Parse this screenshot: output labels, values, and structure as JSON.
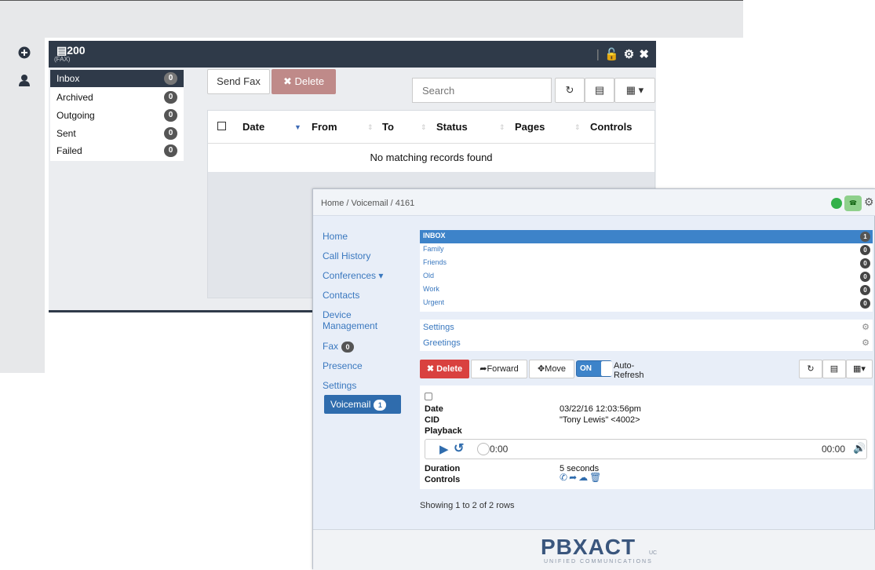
{
  "fax": {
    "extension": "200",
    "subtitle": "(FAX)",
    "folders": [
      {
        "label": "Inbox",
        "count": "0"
      },
      {
        "label": "Archived",
        "count": "0"
      },
      {
        "label": "Outgoing",
        "count": "0"
      },
      {
        "label": "Sent",
        "count": "0"
      },
      {
        "label": "Failed",
        "count": "0"
      }
    ],
    "send_label": "Send Fax",
    "delete_label": "Delete",
    "search_placeholder": "Search",
    "columns": [
      "Date",
      "From",
      "To",
      "Status",
      "Pages",
      "Controls"
    ],
    "empty_message": "No matching records found"
  },
  "voicemail": {
    "breadcrumb": "Home / Voicemail / 4161",
    "avatar_text": "☎",
    "nav": {
      "home": "Home",
      "call_history": "Call History",
      "conferences": "Conferences ▾",
      "contacts": "Contacts",
      "device_1": "Device",
      "device_2": "Management",
      "fax": "Fax",
      "fax_count": "0",
      "presence": "Presence",
      "settings": "Settings",
      "voicemail": "Voicemail",
      "voicemail_count": "1"
    },
    "folders": [
      {
        "label": "INBOX",
        "count": "1"
      },
      {
        "label": "Family",
        "count": "0"
      },
      {
        "label": "Friends",
        "count": "0"
      },
      {
        "label": "Old",
        "count": "0"
      },
      {
        "label": "Work",
        "count": "0"
      },
      {
        "label": "Urgent",
        "count": "0"
      }
    ],
    "settings_label": "Settings",
    "greetings_label": "Greetings",
    "toolbar": {
      "delete": "Delete",
      "forward": "Forward",
      "move": "Move",
      "toggle": "ON",
      "auto_refresh": "Auto-Refresh"
    },
    "record": {
      "date_label": "Date",
      "date_value": "03/22/16 12:03:56pm",
      "cid_label": "CID",
      "cid_value": "\"Tony Lewis\" <4002>",
      "playback_label": "Playback",
      "current_time": "0:00",
      "total_time": "00:00",
      "duration_label": "Duration",
      "duration_value": "5 seconds",
      "controls_label": "Controls"
    },
    "showing": "Showing 1 to 2 of 2 rows",
    "logo": "PBXACT",
    "logo_sub": "UNIFIED COMMUNICATIONS",
    "logo_suffix": "UC"
  }
}
